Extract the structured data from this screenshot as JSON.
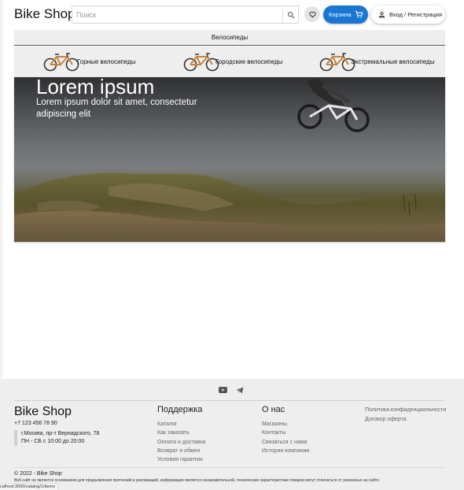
{
  "header": {
    "logo": "Bike Shop",
    "search_placeholder": "Поиск",
    "cart_label": "Корзина",
    "login_label": "Вход / Регистрация"
  },
  "catalog": {
    "title": "Велосипеды",
    "categories": [
      {
        "label": "Горные велосипеды",
        "icon": "bike-icon"
      },
      {
        "label": "Городские велосипеды",
        "icon": "bike-icon"
      },
      {
        "label": "Экстремальные велосипеды",
        "icon": "bike-icon"
      }
    ]
  },
  "hero": {
    "title": "Lorem ipsum",
    "subtitle": "Lorem ipsum dolor sit amet, consectetur adipiscing elit"
  },
  "footer": {
    "social": [
      "youtube-icon",
      "telegram-icon"
    ],
    "logo": "Bike Shop",
    "phone": "+7 123 456 78 90",
    "address": "г.Москва, пр-т Вернадского, 78",
    "hours": "ПН - СБ с 10:00 до 20:00",
    "support": {
      "title": "Поддержка",
      "links": [
        "Каталог",
        "Как заказать",
        "Оплата и доставка",
        "Возврат и обмен",
        "Условия гарантии"
      ]
    },
    "about": {
      "title": "О нас",
      "links": [
        "Магазины",
        "Контакты",
        "Связаться с нами",
        "История компании"
      ]
    },
    "legal": [
      "Политика конфиденциальности",
      "Договор оферта"
    ],
    "copyright": "© 2022 - Bike Shop",
    "disclaimer": "Веб-сайт не является основанием для предъявления претензий и рекламаций, информация является ознакомительной, технические характеристики товаров могут отличаться от указанных на сайте."
  },
  "status_bar": {
    "url": "calhost:3000/catalog/1/items"
  },
  "colors": {
    "accent": "#1976d2",
    "menu_bg": "#eeeeee",
    "footer_bg": "#eeeeee"
  }
}
